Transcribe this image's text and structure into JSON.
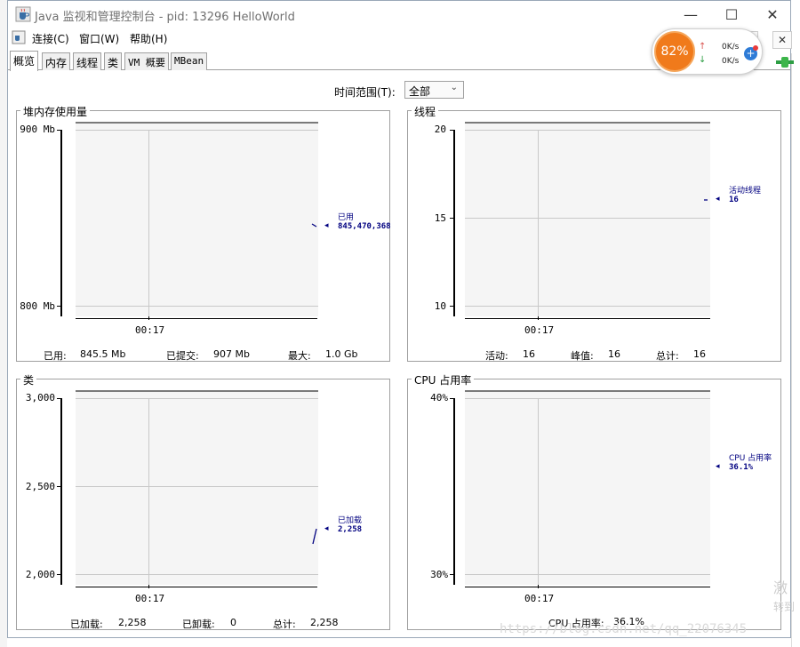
{
  "window": {
    "title": "Java 监视和管理控制台 - pid: 13296 HelloWorld",
    "controls": {
      "minimize": "—",
      "maximize": "☐",
      "close": "✕"
    }
  },
  "menu": {
    "items": [
      "连接(C)",
      "窗口(W)",
      "帮助(H)"
    ]
  },
  "tabs": [
    "概览",
    "内存",
    "线程",
    "类",
    "VM 概要",
    "MBean"
  ],
  "active_tab": "概览",
  "time_range": {
    "label": "时间范围(T):",
    "value": "全部"
  },
  "panels": {
    "heap": {
      "title": "堆内存使用量",
      "y_ticks": [
        "900 Mb",
        "800 Mb"
      ],
      "x_tick": "00:17",
      "legend_label": "已用",
      "legend_value": "845,470,368",
      "summary": {
        "used_label": "已用:",
        "used_value": "845.5 Mb",
        "committed_label": "已提交:",
        "committed_value": "907 Mb",
        "max_label": "最大:",
        "max_value": "1.0 Gb"
      }
    },
    "threads": {
      "title": "线程",
      "y_ticks": [
        "20",
        "15",
        "10"
      ],
      "x_tick": "00:17",
      "legend_label": "活动线程",
      "legend_value": "16",
      "summary": {
        "live_label": "活动:",
        "live_value": "16",
        "peak_label": "峰值:",
        "peak_value": "16",
        "total_label": "总计:",
        "total_value": "16"
      }
    },
    "classes": {
      "title": "类",
      "y_ticks": [
        "3,000",
        "2,500",
        "2,000"
      ],
      "x_tick": "00:17",
      "legend_label": "已加载",
      "legend_value": "2,258",
      "summary": {
        "loaded_label": "已加载:",
        "loaded_value": "2,258",
        "unloaded_label": "已卸载:",
        "unloaded_value": "0",
        "total_label": "总计:",
        "total_value": "2,258"
      }
    },
    "cpu": {
      "title": "CPU 占用率",
      "y_ticks": [
        "40%",
        "30%"
      ],
      "x_tick": "00:17",
      "legend_label": "CPU 占用率",
      "legend_value": "36.1%",
      "summary": {
        "usage_label": "CPU 占用率:",
        "usage_value": "36.1%"
      }
    }
  },
  "network_widget": {
    "percent": "82%",
    "upload": "0K/s",
    "download": "0K/s"
  },
  "watermark": "https://blog.csdn.net/qq_22076345",
  "side_watermark": [
    "激",
    "转到"
  ],
  "colors": {
    "series": "#000080",
    "plot_bg": "#f5f5f5",
    "widget_orange": "#f07a1b"
  }
}
